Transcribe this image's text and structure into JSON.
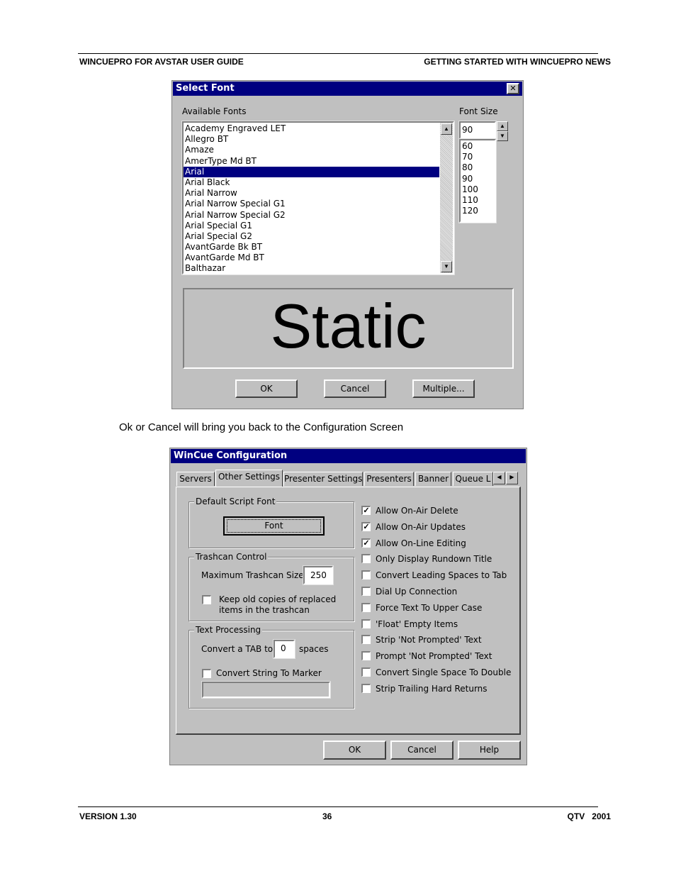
{
  "header": {
    "left": "WINCUEPRO FOR AVSTAR USER GUIDE",
    "right": "GETTING STARTED WITH WINCUEPRO NEWS"
  },
  "select_font": {
    "title": "Select Font",
    "available_label": "Available Fonts",
    "size_label": "Font Size",
    "fonts": [
      "Academy Engraved LET",
      "Allegro BT",
      "Amaze",
      "AmerType Md BT",
      "Arial",
      "Arial Black",
      "Arial Narrow",
      "Arial Narrow Special G1",
      "Arial Narrow Special G2",
      "Arial Special G1",
      "Arial Special G2",
      "AvantGarde Bk BT",
      "AvantGarde Md BT",
      "Balthazar"
    ],
    "selected_font": "Arial",
    "size_value": "90",
    "sizes": [
      "60",
      "70",
      "80",
      "90",
      "100",
      "110",
      "120"
    ],
    "preview": "Static",
    "ok": "OK",
    "cancel": "Cancel",
    "multiple": "Multiple..."
  },
  "caption": "Ok or Cancel will bring you back to the Configuration Screen",
  "config": {
    "title": "WinCue Configuration",
    "tabs": [
      "Servers",
      "Other Settings",
      "Presenter Settings",
      "Presenters",
      "Banner",
      "Queue L"
    ],
    "active_tab": "Other Settings",
    "default_font_group": "Default Script Font",
    "font_button": "Font",
    "trashcan_group": "Trashcan Control",
    "max_trash_label": "Maximum Trashcan Size",
    "max_trash_value": "250",
    "keep_copies_line1": "Keep old copies of replaced",
    "keep_copies_line2": "items in the trashcan",
    "text_group": "Text Processing",
    "convert_tab_label": "Convert a TAB to",
    "convert_tab_value": "0",
    "spaces_label": "spaces",
    "convert_marker": "Convert String To Marker",
    "options": [
      {
        "label": "Allow On-Air Delete",
        "checked": true
      },
      {
        "label": "Allow On-Air Updates",
        "checked": true
      },
      {
        "label": "Allow On-Line Editing",
        "checked": true
      },
      {
        "label": "Only Display Rundown Title",
        "checked": false
      },
      {
        "label": "Convert Leading Spaces to Tab",
        "checked": false
      },
      {
        "label": "Dial Up Connection",
        "checked": false
      },
      {
        "label": "Force Text To Upper Case",
        "checked": false
      },
      {
        "label": "'Float' Empty Items",
        "checked": false
      },
      {
        "label": "Strip 'Not Prompted' Text",
        "checked": false
      },
      {
        "label": "Prompt 'Not Prompted' Text",
        "checked": false
      },
      {
        "label": "Convert Single Space To Double",
        "checked": false
      },
      {
        "label": "Strip Trailing Hard Returns",
        "checked": false
      }
    ],
    "ok": "OK",
    "cancel": "Cancel",
    "help": "Help"
  },
  "footer": {
    "left": "VERSION 1.30",
    "center": "36",
    "right": "QTV   2001"
  }
}
